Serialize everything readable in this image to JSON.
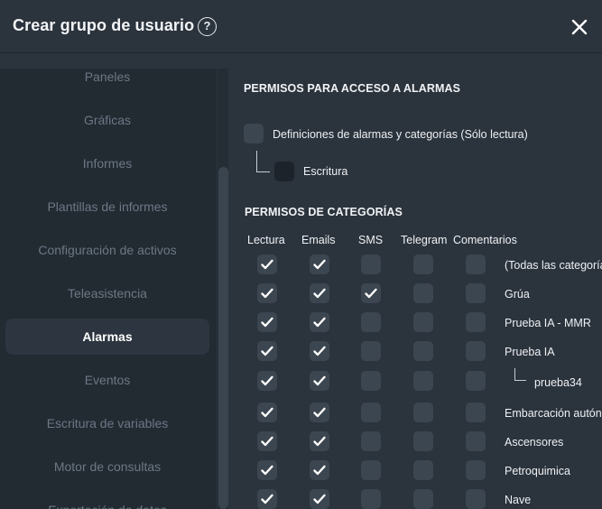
{
  "dialog": {
    "title": "Crear grupo de usuario",
    "help_icon": "question-circle-icon",
    "close_icon": "close-icon"
  },
  "sidebar": {
    "items": [
      {
        "label": "Paneles",
        "active": false
      },
      {
        "label": "Gráficas",
        "active": false
      },
      {
        "label": "Informes",
        "active": false
      },
      {
        "label": "Plantillas de informes",
        "active": false
      },
      {
        "label": "Configuración de activos",
        "active": false
      },
      {
        "label": "Teleasistencia",
        "active": false
      },
      {
        "label": "Alarmas",
        "active": true
      },
      {
        "label": "Eventos",
        "active": false
      },
      {
        "label": "Escritura de variables",
        "active": false
      },
      {
        "label": "Motor de consultas",
        "active": false
      },
      {
        "label": "Exportación de datos",
        "active": false
      }
    ]
  },
  "alarm_access": {
    "title": "PERMISOS PARA ACCESO A ALARMAS",
    "definitions_label": "Definiciones de alarmas y categorías (Sólo lectura)",
    "definitions_checked": false,
    "write_label": "Escritura",
    "write_checked": false
  },
  "categories": {
    "title": "PERMISOS DE CATEGORÍAS",
    "columns": [
      "Lectura",
      "Emails",
      "SMS",
      "Telegram",
      "Comentarios"
    ],
    "rows": [
      {
        "name": "(Todas las categorías)",
        "checks": [
          true,
          true,
          false,
          false,
          false
        ],
        "indent": false
      },
      {
        "name": "Grúa",
        "checks": [
          true,
          true,
          true,
          false,
          false
        ],
        "indent": false
      },
      {
        "name": "Prueba IA - MMR",
        "checks": [
          true,
          true,
          false,
          false,
          false
        ],
        "indent": false
      },
      {
        "name": "Prueba IA",
        "checks": [
          true,
          true,
          false,
          false,
          false
        ],
        "indent": false
      },
      {
        "name": "prueba34",
        "checks": [
          true,
          true,
          false,
          false,
          false
        ],
        "indent": true
      },
      {
        "name": "Embarcación autónoma",
        "checks": [
          true,
          true,
          false,
          false,
          false
        ],
        "indent": false
      },
      {
        "name": "Ascensores",
        "checks": [
          true,
          true,
          false,
          false,
          false
        ],
        "indent": false
      },
      {
        "name": "Petroquimica",
        "checks": [
          true,
          true,
          false,
          false,
          false
        ],
        "indent": false
      },
      {
        "name": "Nave",
        "checks": [
          true,
          true,
          false,
          false,
          false
        ],
        "indent": false
      }
    ]
  },
  "colors": {
    "background": "#2b333d",
    "sidebar": "#222a32",
    "checkbox": "#3c4650",
    "checkbox_dark": "#1d232a",
    "active_item": "#2d3640"
  }
}
